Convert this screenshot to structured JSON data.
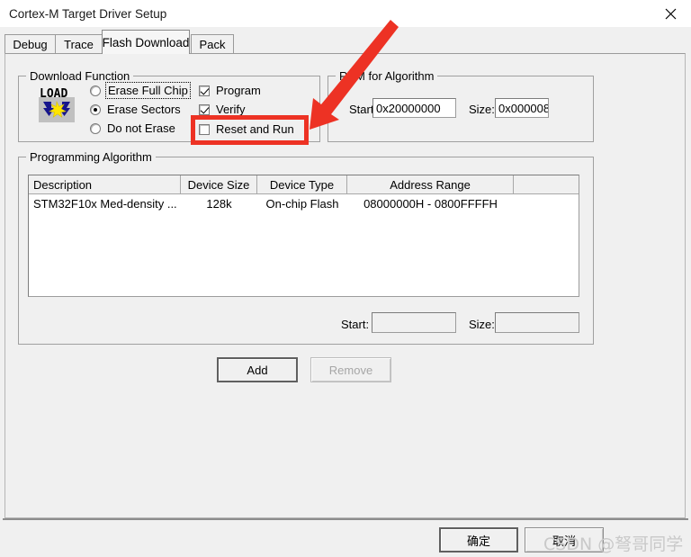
{
  "window": {
    "title": "Cortex-M Target Driver Setup",
    "close_icon": "close-icon"
  },
  "tabs": [
    {
      "label": "Debug",
      "active": false
    },
    {
      "label": "Trace",
      "active": false
    },
    {
      "label": "Flash Download",
      "active": true
    },
    {
      "label": "Pack",
      "active": false
    }
  ],
  "download_function": {
    "title": "Download Function",
    "icon_label": "LOAD",
    "radios": [
      {
        "label": "Erase Full Chip",
        "checked": false,
        "focused": true
      },
      {
        "label": "Erase Sectors",
        "checked": true,
        "focused": false
      },
      {
        "label": "Do not Erase",
        "checked": false,
        "focused": false
      }
    ],
    "checkboxes": [
      {
        "label": "Program",
        "checked": true
      },
      {
        "label": "Verify",
        "checked": true
      },
      {
        "label": "Reset and Run",
        "checked": false,
        "highlighted": true
      }
    ]
  },
  "ram_for_algorithm": {
    "title": "RAM for Algorithm",
    "start_label": "Start:",
    "start_value": "0x20000000",
    "size_label": "Size:",
    "size_value": "0x000008"
  },
  "programming_algorithm": {
    "title": "Programming Algorithm",
    "columns": [
      "Description",
      "Device Size",
      "Device Type",
      "Address Range",
      ""
    ],
    "rows": [
      {
        "description": "STM32F10x Med-density ...",
        "device_size": "128k",
        "device_type": "On-chip Flash",
        "address_range": "08000000H - 0800FFFFH"
      }
    ],
    "start_label": "Start:",
    "start_value": "",
    "size_label": "Size:",
    "size_value": "",
    "add_label": "Add",
    "remove_label": "Remove"
  },
  "footer": {
    "ok_label": "确定",
    "cancel_label": "取消"
  },
  "watermark": {
    "text": "CSDN @弩哥同学"
  },
  "annotation": {
    "arrow_color": "#ed3224",
    "highlight_color": "#ed3224"
  }
}
